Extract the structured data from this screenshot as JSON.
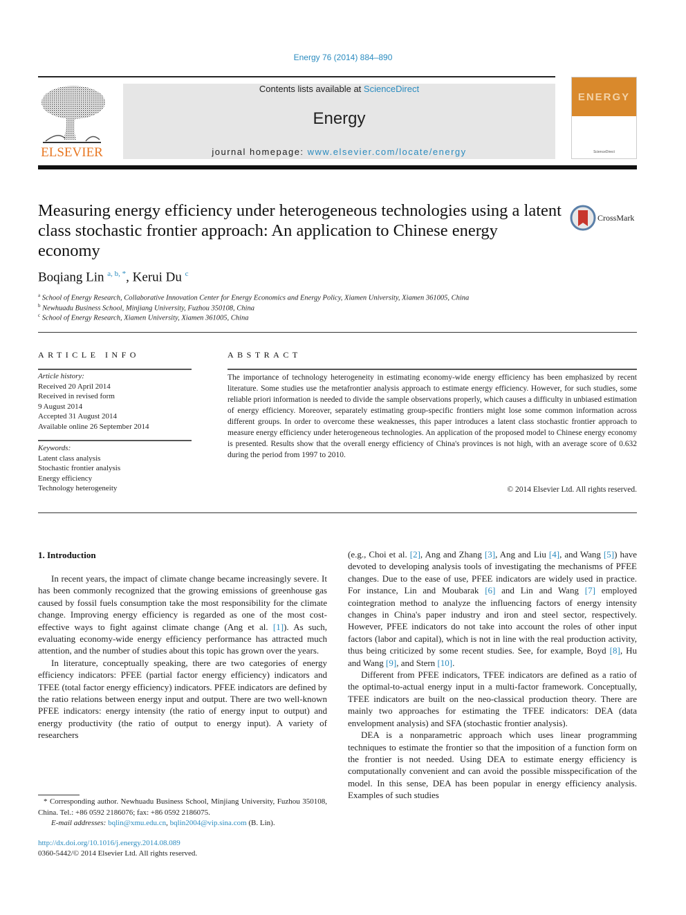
{
  "header": {
    "citation": "Energy 76 (2014) 884–890",
    "contents_prefix": "Contents lists available at ",
    "contents_link": "ScienceDirect",
    "journal_name": "Energy",
    "homepage_prefix": "journal homepage: ",
    "homepage_link": "www.elsevier.com/locate/energy",
    "publisher_logo_text": "ELSEVIER",
    "cover_word": "ENERGY",
    "cover_caption": "ScienceDirect",
    "brand_color": "#e87722",
    "link_color": "#2a8bbf"
  },
  "article": {
    "title": "Measuring energy efficiency under heterogeneous technologies using a latent class stochastic frontier approach: An application to Chinese energy economy",
    "crossmark_label": "CrossMark",
    "authors": [
      {
        "name": "Boqiang Lin",
        "marks": "a, b, *"
      },
      {
        "name": "Kerui Du",
        "marks": "c"
      }
    ],
    "author_separator": ", ",
    "affiliations": [
      {
        "mark": "a",
        "text": "School of Energy Research, Collaborative Innovation Center for Energy Economics and Energy Policy, Xiamen University, Xiamen 361005, China"
      },
      {
        "mark": "b",
        "text": "Newhuadu Business School, Minjiang University, Fuzhou 350108, China"
      },
      {
        "mark": "c",
        "text": "School of Energy Research, Xiamen University, Xiamen 361005, China"
      }
    ]
  },
  "article_info": {
    "heading": "ARTICLE INFO",
    "history_label": "Article history:",
    "history": [
      "Received 20 April 2014",
      "Received in revised form",
      "9 August 2014",
      "Accepted 31 August 2014",
      "Available online 26 September 2014"
    ],
    "keywords_label": "Keywords:",
    "keywords": [
      "Latent class analysis",
      "Stochastic frontier analysis",
      "Energy efficiency",
      "Technology heterogeneity"
    ]
  },
  "abstract": {
    "heading": "ABSTRACT",
    "text": "The importance of technology heterogeneity in estimating economy-wide energy efficiency has been emphasized by recent literature. Some studies use the metafrontier analysis approach to estimate energy efficiency. However, for such studies, some reliable priori information is needed to divide the sample observations properly, which causes a difficulty in unbiased estimation of energy efficiency. Moreover, separately estimating group-specific frontiers might lose some common information across different groups. In order to overcome these weaknesses, this paper introduces a latent class stochastic frontier approach to measure energy efficiency under heterogeneous technologies. An application of the proposed model to Chinese energy economy is presented. Results show that the overall energy efficiency of China's provinces is not high, with an average score of 0.632 during the period from 1997 to 2010.",
    "copyright": "© 2014 Elsevier Ltd. All rights reserved."
  },
  "body": {
    "section_heading": "1.  Introduction",
    "left_paragraphs": [
      {
        "segments": [
          {
            "t": "In recent years, the impact of climate change became increasingly severe. It has been commonly recognized that the growing emissions of greenhouse gas caused by fossil fuels consumption take the most responsibility for the climate change. Improving energy efficiency is regarded as one of the most cost-effective ways to fight against climate change (Ang et al. "
          },
          {
            "ref": "[1]"
          },
          {
            "t": "). As such, evaluating economy-wide energy efficiency performance has attracted much attention, and the number of studies about this topic has grown over the years."
          }
        ]
      },
      {
        "segments": [
          {
            "t": "In literature, conceptually speaking, there are two categories of energy efficiency indicators: PFEE (partial factor energy efficiency) indicators and TFEE (total factor energy efficiency) indicators. PFEE indicators are defined by the ratio relations between energy input and output. There are two well-known PFEE indicators: energy intensity (the ratio of energy input to output) and energy productivity (the ratio of output to energy input). A variety of researchers"
          }
        ]
      }
    ],
    "right_paragraphs": [
      {
        "noindent": true,
        "segments": [
          {
            "t": "(e.g., Choi et al. "
          },
          {
            "ref": "[2]"
          },
          {
            "t": ", Ang and Zhang "
          },
          {
            "ref": "[3]"
          },
          {
            "t": ", Ang and Liu "
          },
          {
            "ref": "[4]"
          },
          {
            "t": ", and Wang "
          },
          {
            "ref": "[5]"
          },
          {
            "t": ") have devoted to developing analysis tools of investigating the mechanisms of PFEE changes. Due to the ease of use, PFEE indicators are widely used in practice. For instance, Lin and Moubarak "
          },
          {
            "ref": "[6]"
          },
          {
            "t": " and Lin and Wang "
          },
          {
            "ref": "[7]"
          },
          {
            "t": " employed cointegration method to analyze the influencing factors of energy intensity changes in China's paper industry and iron and steel sector, respectively. However, PFEE indicators do not take into account the roles of other input factors (labor and capital), which is not in line with the real production activity, thus being criticized by some recent studies. See, for example, Boyd "
          },
          {
            "ref": "[8]"
          },
          {
            "t": ", Hu and Wang "
          },
          {
            "ref": "[9]"
          },
          {
            "t": ", and Stern "
          },
          {
            "ref": "[10]"
          },
          {
            "t": "."
          }
        ]
      },
      {
        "segments": [
          {
            "t": "Different from PFEE indicators, TFEE indicators are defined as a ratio of the optimal-to-actual energy input in a multi-factor framework. Conceptually, TFEE indicators are built on the neo-classical production theory. There are mainly two approaches for estimating the TFEE indicators: DEA (data envelopment analysis) and SFA (stochastic frontier analysis)."
          }
        ]
      },
      {
        "segments": [
          {
            "t": "DEA is a nonparametric approach which uses linear programming techniques to estimate the frontier so that the imposition of a function form on the frontier is not needed. Using DEA to estimate energy efficiency is computationally convenient and can avoid the possible misspecification of the model. In this sense, DEA has been popular in energy efficiency analysis. Examples of such studies"
          }
        ]
      }
    ]
  },
  "footnote": {
    "corresponding": "* Corresponding author. Newhuadu Business School, Minjiang University, Fuzhou 350108, China. Tel.: +86 0592 2186076; fax: +86 0592 2186075.",
    "email_label": "E-mail addresses: ",
    "emails": [
      "bqlin@xmu.edu.cn",
      "bqlin2004@vip.sina.com"
    ],
    "email_suffix": " (B. Lin)."
  },
  "doi": {
    "link": "http://dx.doi.org/10.1016/j.energy.2014.08.089",
    "issn_line": "0360-5442/© 2014 Elsevier Ltd. All rights reserved."
  }
}
